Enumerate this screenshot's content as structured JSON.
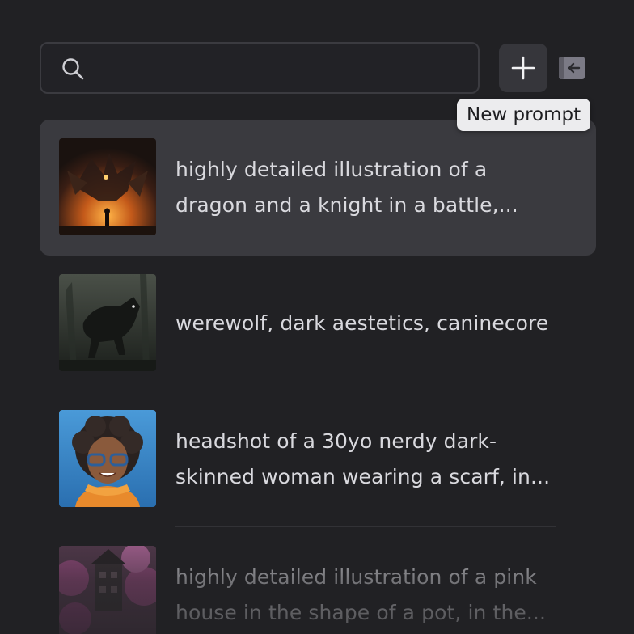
{
  "search": {
    "placeholder": "",
    "value": ""
  },
  "toolbar": {
    "new_prompt_tooltip": "New prompt",
    "new_icon": "plus-icon",
    "collapse_icon": "collapse-left-icon"
  },
  "prompts": [
    {
      "line1": "highly detailed illustration of a",
      "line2": "dragon and a knight in a battle,...",
      "active": true,
      "thumb_icon": "dragon-thumbnail"
    },
    {
      "line1": "werewolf, dark aestetics, caninecore",
      "line2": "",
      "active": false,
      "thumb_icon": "werewolf-thumbnail"
    },
    {
      "line1": "headshot of a 30yo nerdy dark-",
      "line2": "skinned woman wearing a scarf, in...",
      "active": false,
      "thumb_icon": "woman-portrait-thumbnail"
    },
    {
      "line1": "highly detailed illustration of a pink",
      "line2": "house in the shape of a pot, in the...",
      "active": false,
      "thumb_icon": "pink-house-thumbnail"
    }
  ],
  "colors": {
    "background": "#212124",
    "active_item": "#3a3a3f",
    "tooltip_bg": "#ececee",
    "text": "#d9d9de"
  }
}
